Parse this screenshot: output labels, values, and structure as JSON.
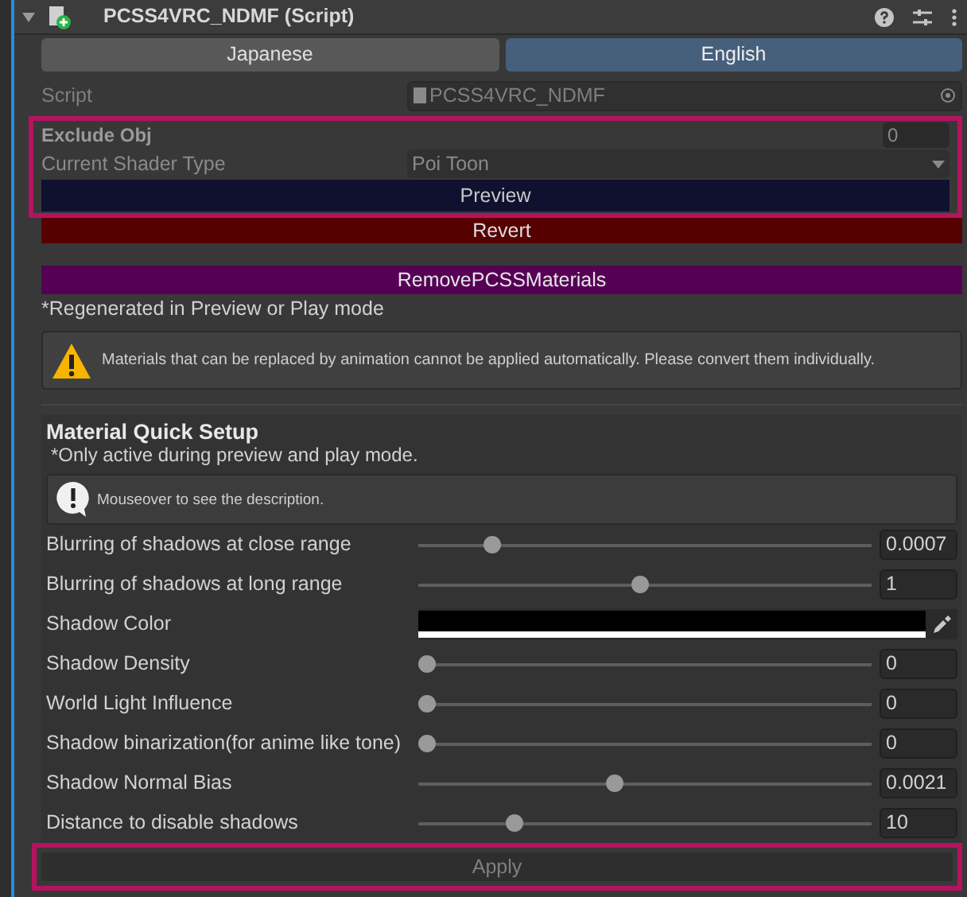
{
  "header": {
    "title": "PCSS4VRC_NDMF (Script)",
    "expanded": true
  },
  "language_tabs": [
    {
      "label": "Japanese",
      "selected": false
    },
    {
      "label": "English",
      "selected": true
    }
  ],
  "script_field": {
    "label": "Script",
    "value": "PCSS4VRC_NDMF"
  },
  "exclude_obj": {
    "label": "Exclude Obj",
    "value": "0"
  },
  "shader_type": {
    "label": "Current Shader Type",
    "value": "Poi Toon"
  },
  "buttons": [
    {
      "label": "Preview",
      "kind": "preview"
    },
    {
      "label": "Revert",
      "kind": "revert"
    },
    {
      "label": "RemovePCSSMaterials",
      "kind": "remove"
    }
  ],
  "regen_note": "*Regenerated in Preview or Play mode",
  "warning": "Materials that can be replaced by animation cannot be applied automatically. Please convert them individually.",
  "quick_setup": {
    "title": "Material Quick Setup",
    "note": "*Only active during preview and play mode.",
    "info": "Mouseover to see the description.",
    "rows": [
      {
        "kind": "slider",
        "label": "Blurring of shadows at close range",
        "level": 0.15,
        "value": "0.0007"
      },
      {
        "kind": "slider",
        "label": "Blurring of shadows at long range",
        "level": 0.49,
        "value": "1"
      },
      {
        "kind": "color",
        "label": "Shadow Color",
        "color": "#000000"
      },
      {
        "kind": "slider",
        "label": "Shadow Density",
        "level": 0,
        "value": "0"
      },
      {
        "kind": "slider",
        "label": "World Light Influence",
        "level": 0,
        "value": "0"
      },
      {
        "kind": "slider",
        "label": "Shadow binarization(for anime like tone)",
        "level": 0,
        "value": "0"
      },
      {
        "kind": "slider",
        "label": "Shadow Normal Bias",
        "level": 0.43,
        "value": "0.0021"
      },
      {
        "kind": "slider",
        "label": "Distance to disable shadows",
        "level": 0.2,
        "value": "10"
      }
    ],
    "apply": {
      "label": "Apply",
      "disabled": true
    }
  }
}
